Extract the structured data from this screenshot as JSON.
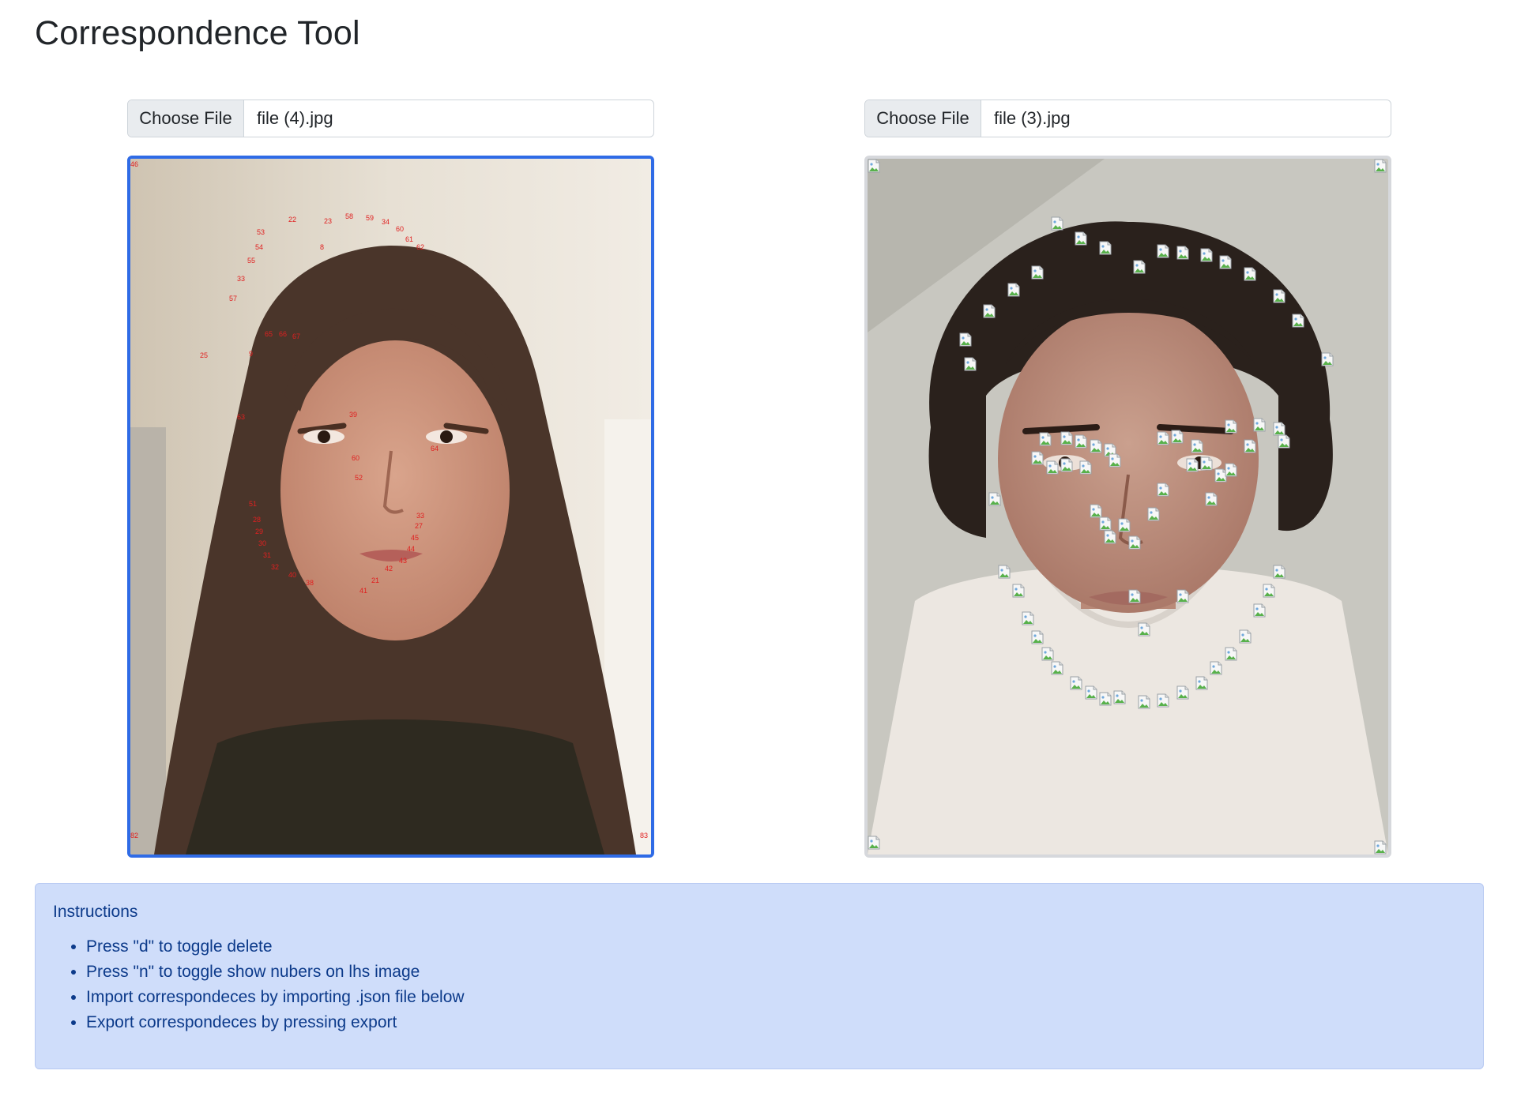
{
  "page": {
    "title": "Correspondence Tool"
  },
  "left_panel": {
    "choose_file_label": "Choose File",
    "file_name": "file (4).jpg",
    "point_labels": [
      "22",
      "23",
      "58",
      "59",
      "34",
      "60",
      "61",
      "62",
      "53",
      "54",
      "55",
      "33",
      "57",
      "8",
      "9",
      "65",
      "66",
      "67",
      "25",
      "63",
      "64",
      "60",
      "52",
      "51",
      "28",
      "29",
      "30",
      "31",
      "32",
      "33",
      "27",
      "45",
      "44",
      "43",
      "42",
      "21",
      "41",
      "40",
      "38",
      "39",
      "46",
      "82",
      "83"
    ]
  },
  "right_panel": {
    "choose_file_label": "Choose File",
    "file_name": "file (3).jpg",
    "marker_icon": "broken-image-icon"
  },
  "instructions": {
    "title": "Instructions",
    "items": [
      "Press \"d\" to toggle delete",
      "Press \"n\" to toggle show nubers on lhs image",
      "Import correspondeces by importing .json file below",
      "Export correspondeces by pressing export"
    ]
  },
  "colors": {
    "active_border": "#2f6be6",
    "inactive_border": "#d6d8dc",
    "landmark_label": "#e02020",
    "instructions_bg": "#cfddfa",
    "instructions_text": "#0c3a8a"
  }
}
